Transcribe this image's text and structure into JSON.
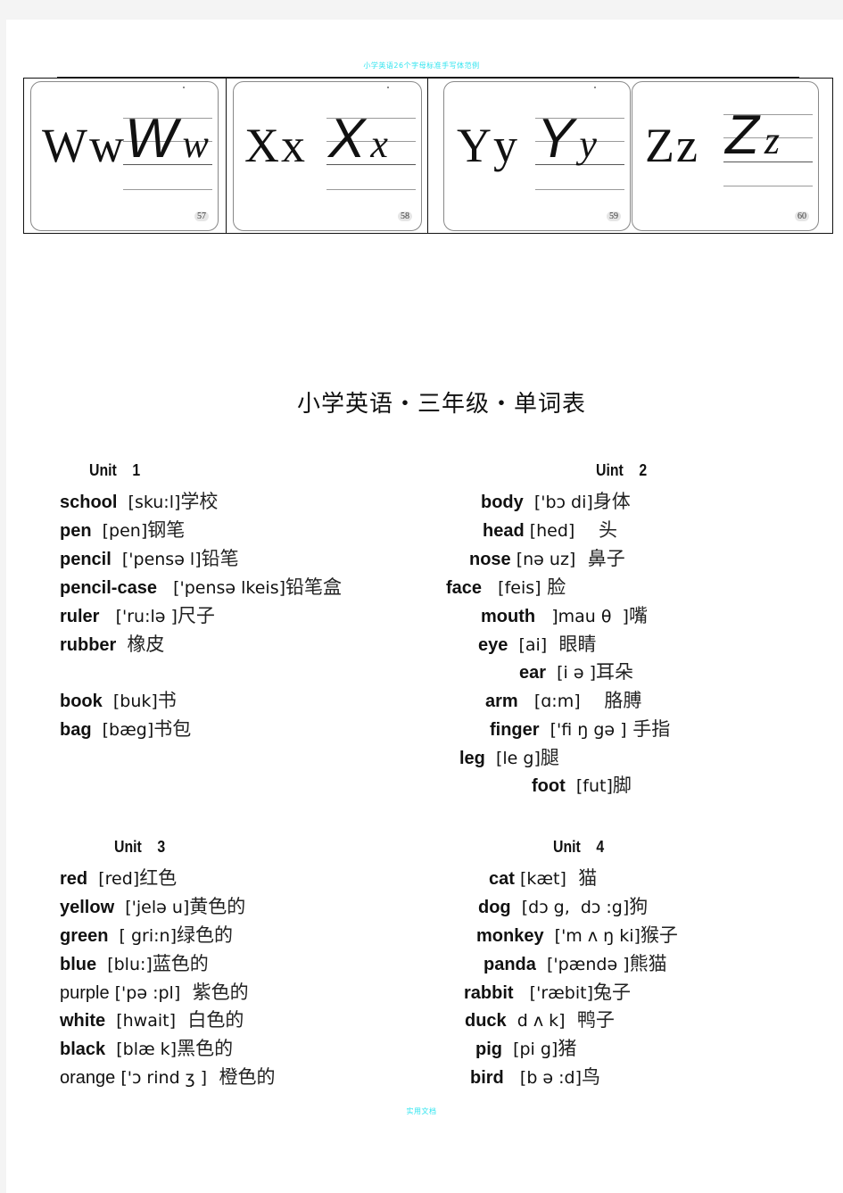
{
  "header_note": "小学英语26个字母标准手写体范例",
  "footer_note": "实用文档",
  "letter_cards": [
    {
      "print": "Ww",
      "script_upper": "W",
      "script_lower": "w",
      "number": "57"
    },
    {
      "print": "Xx",
      "script_upper": "X",
      "script_lower": "x",
      "number": "58"
    },
    {
      "print": "Yy",
      "script_upper": "Y",
      "script_lower": "y",
      "number": "59"
    },
    {
      "print": "Zz",
      "script_upper": "Z",
      "script_lower": "z",
      "number": "60"
    }
  ],
  "title": "小学英语・三年级・单词表",
  "units": [
    {
      "heading": "Unit    1",
      "entries": [
        {
          "word": "school",
          "ipa": "  [sku:l]",
          "zh": "学校"
        },
        {
          "word": "pen",
          "ipa": "  [pen]",
          "zh": "钢笔"
        },
        {
          "word": "pencil",
          "ipa": "  ['pensə l]",
          "zh": "铅笔"
        },
        {
          "word": "pencil-case",
          "ipa": "   ['pensə lkeis]",
          "zh": "铅笔盒"
        },
        {
          "word": "ruler",
          "ipa": "   ['ru:lə ]",
          "zh": "尺子"
        },
        {
          "word": "rubber",
          "ipa": "  ",
          "zh": "橡皮"
        },
        {
          "word": "book",
          "ipa": "  [buk]",
          "zh": "书"
        },
        {
          "word": "bag",
          "ipa": "  [bæg]",
          "zh": "书包"
        }
      ]
    },
    {
      "heading": "Uint    2",
      "entries": [
        {
          "word": "body",
          "ipa": "  ['bɔ di]",
          "zh": "身体"
        },
        {
          "word": "head",
          "ipa": " [hed]",
          "zh": "    头"
        },
        {
          "word": "nose",
          "ipa": " [nə uz]",
          "zh": "  鼻子"
        },
        {
          "word": "face",
          "ipa": "   [feis]",
          "zh": " 脸"
        },
        {
          "word": "mouth",
          "ipa": "   ]mau θ  ]",
          "zh": "嘴"
        },
        {
          "word": "eye",
          "ipa": "  [ai]",
          "zh": "  眼睛"
        },
        {
          "word": "ear",
          "ipa": "  [i ə ]",
          "zh": "耳朵"
        },
        {
          "word": "arm",
          "ipa": "   [ɑ:m]",
          "zh": "    胳膊"
        },
        {
          "word": "finger",
          "ipa": "  ['fi ŋ gə ]",
          "zh": " 手指"
        },
        {
          "word": "leg",
          "ipa": "  [le g]",
          "zh": "腿"
        },
        {
          "word": "foot",
          "ipa": "  [fut]",
          "zh": "脚"
        }
      ]
    },
    {
      "heading": "Unit    3",
      "entries": [
        {
          "word": "red",
          "ipa": "  [red]",
          "zh": "红色"
        },
        {
          "word": "yellow",
          "ipa": "  ['jelə u]",
          "zh": "黄色的"
        },
        {
          "word": "green",
          "ipa": "  [ gri:n]",
          "zh": "绿色的"
        },
        {
          "word": "blue",
          "ipa": "  [blu:]",
          "zh": "蓝色的"
        },
        {
          "word": "purple",
          "ipa": " ['pə :pl]",
          "zh": "  紫色的"
        },
        {
          "word": "white",
          "ipa": "  [hwait]",
          "zh": "  白色的"
        },
        {
          "word": "black",
          "ipa": "  [blæ k]",
          "zh": "黑色的"
        },
        {
          "word": "orange",
          "ipa": " ['ɔ rind ʒ ]",
          "zh": "  橙色的"
        }
      ]
    },
    {
      "heading": "Unit    4",
      "entries": [
        {
          "word": "cat",
          "ipa": " [kæt]",
          "zh": "  猫"
        },
        {
          "word": "dog",
          "ipa": "  [dɔ g,  dɔ :g]",
          "zh": "狗"
        },
        {
          "word": "monkey",
          "ipa": "  ['m ʌ ŋ ki]",
          "zh": "猴子"
        },
        {
          "word": "panda",
          "ipa": "  ['pændə ]",
          "zh": "熊猫"
        },
        {
          "word": "rabbit",
          "ipa": "   ['ræbit]",
          "zh": "兔子"
        },
        {
          "word": "duck",
          "ipa": "  d ʌ k]",
          "zh": "  鸭子"
        },
        {
          "word": "pig",
          "ipa": "  [pi g]",
          "zh": "猪"
        },
        {
          "word": "bird",
          "ipa": "   [b ə :d]",
          "zh": "鸟"
        }
      ]
    }
  ]
}
